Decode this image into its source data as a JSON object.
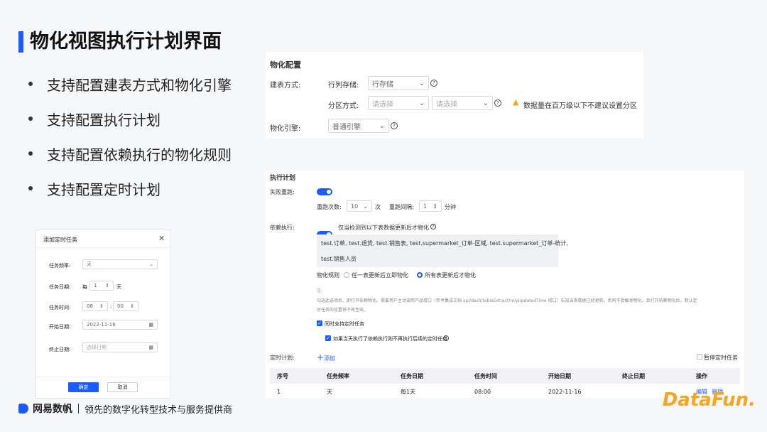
{
  "slide": {
    "title": "物化视图执行计划界面",
    "bullets": [
      "支持配置建表方式和物化引擎",
      "支持配置执行计划",
      "支持配置依赖执行的物化规则",
      "支持配置定时计划"
    ]
  },
  "materialize_panel": {
    "heading": "物化配置",
    "build_label": "建表方式:",
    "storage_label": "行列存储:",
    "storage_value": "行存储",
    "partition_label": "分区方式:",
    "partition_placeholder_1": "请选择",
    "partition_placeholder_2": "请选择",
    "warning_text": "数据量在百万级以下不建议设置分区",
    "engine_label": "物化引擎:",
    "engine_value": "普通引擎"
  },
  "plan_panel": {
    "heading": "执行计划",
    "retry_label": "失败重跑:",
    "retry_count_label": "重跑次数:",
    "retry_count_value": "10",
    "retry_count_unit": "次",
    "retry_interval_label": "重跑间隔:",
    "retry_interval_value": "1",
    "retry_interval_unit": "分钟",
    "depend_label": "依赖执行:",
    "depend_toggle_text": "仅当检测到以下表数据更新后才物化",
    "depend_tables_line1": "test.订单, test.退货, test.销售表, test.supermarket_订单-区域, test.supermarket_订单-统计,",
    "depend_tables_line2": "test.销售人员",
    "rule_label": "物化规则",
    "rule_option_1": "任一表更新后立即物化",
    "rule_option_2": "所有表更新后才物化",
    "note_title": "注:",
    "note_line1": "勾选此选项后，即打开依赖物化。需要用户主动调用产品接口（参考集成文档 api/dash/tableExtract/relyUpdatedTime 接口）告知该表数据已经更新。否则不会触发物化。且打开依赖物化后，默认定",
    "note_line2": "时任务的设置将不再生效。",
    "also_schedule": "同时支持定时任务",
    "skip_schedule": "如果当天执行了依赖执行则不再执行后续的定时任务",
    "schedule_label": "定时计划:",
    "add_label": "添加",
    "pause_label": "暂停定时任务",
    "table_headers": [
      "序号",
      "任务频率",
      "任务日期",
      "任务时间",
      "开始日期",
      "终止日期",
      "操作"
    ],
    "table_row": [
      "1",
      "天",
      "每1天",
      "08:00",
      "2022-11-16",
      ""
    ],
    "edit_label": "编辑",
    "delete_label": "删除"
  },
  "dialog": {
    "title": "添加定时任务",
    "freq_label": "任务频率:",
    "freq_value": "天",
    "date_label": "任务日期:",
    "date_prefix": "每",
    "date_value": "1",
    "date_unit": "天",
    "time_label": "任务时间:",
    "hour_value": "08",
    "minute_value": "00",
    "start_label": "开始日期:",
    "start_value": "2022-11-16",
    "end_label": "终止日期:",
    "end_placeholder": "选择日期",
    "ok_label": "确定",
    "cancel_label": "取消"
  },
  "footer": {
    "brand": "网易数帆",
    "slogan": "领先的数字化转型技术与服务提供商",
    "datafun": "DataFun."
  },
  "colors": {
    "accent": "#1a5cff",
    "warning": "#f5a623"
  }
}
